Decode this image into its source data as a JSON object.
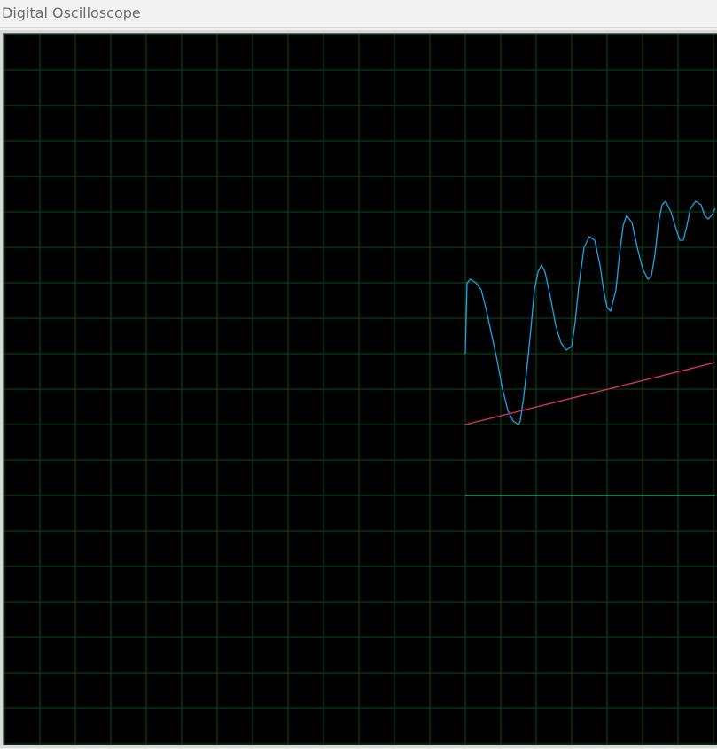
{
  "window": {
    "title": "Digital Oscilloscope"
  },
  "colors": {
    "background": "#000000",
    "grid": "#0b4d12",
    "trace_blue": "#1aa6e8",
    "trace_pink": "#e0306a",
    "trace_green": "#19c46a"
  },
  "chart_data": {
    "type": "line",
    "grid": true,
    "divisions": {
      "x": 20,
      "y": 20
    },
    "series": [
      {
        "color": "#1aa6e8",
        "x": [
          0,
          0.05,
          0.15,
          0.3,
          0.45,
          0.6,
          0.75,
          0.9,
          1.05,
          1.2,
          1.35,
          1.5,
          1.55,
          1.65,
          1.75,
          1.85,
          1.95,
          2.05,
          2.15,
          2.25,
          2.4,
          2.55,
          2.7,
          2.85,
          3.0,
          3.1,
          3.2,
          3.35,
          3.5,
          3.65,
          3.8,
          3.9,
          4.0,
          4.1,
          4.25,
          4.35,
          4.45,
          4.55,
          4.7,
          4.85,
          5.0,
          5.15,
          5.25,
          5.35,
          5.45,
          5.55,
          5.65,
          5.8,
          5.95,
          6.05,
          6.15,
          6.25,
          6.35,
          6.5,
          6.65,
          6.75,
          6.85,
          6.95,
          7.05
        ],
        "y": [
          11.0,
          13.0,
          13.1,
          13.0,
          12.8,
          12.2,
          11.5,
          10.8,
          10.0,
          9.4,
          9.1,
          9.0,
          9.1,
          9.8,
          10.7,
          11.7,
          12.8,
          13.3,
          13.5,
          13.3,
          12.6,
          11.8,
          11.3,
          11.1,
          11.2,
          11.9,
          12.9,
          14.0,
          14.3,
          14.2,
          13.5,
          12.8,
          12.3,
          12.2,
          12.8,
          13.8,
          14.6,
          14.9,
          14.7,
          14.0,
          13.4,
          13.1,
          13.2,
          13.8,
          14.7,
          15.2,
          15.3,
          15.0,
          14.5,
          14.2,
          14.2,
          14.6,
          15.1,
          15.3,
          15.2,
          14.9,
          14.8,
          14.9,
          15.1
        ]
      },
      {
        "color": "#e0306a",
        "x": [
          0,
          7.05
        ],
        "y": [
          9.0,
          10.75
        ]
      },
      {
        "color": "#19c46a",
        "x": [
          0,
          7.05
        ],
        "y": [
          7.0,
          7.0
        ]
      }
    ]
  }
}
